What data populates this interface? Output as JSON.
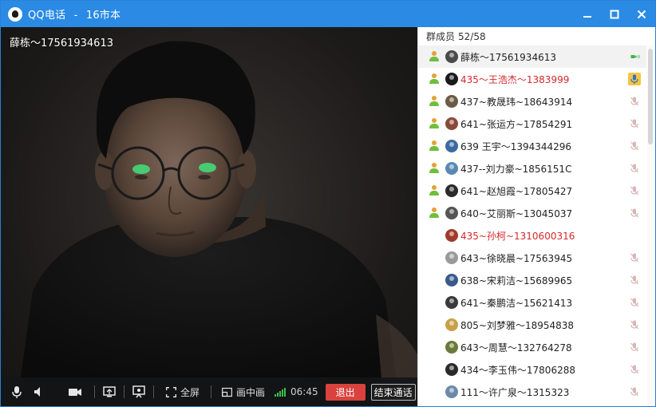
{
  "window": {
    "app_name": "QQ电话",
    "title_sep": "-",
    "group_name": "16市本"
  },
  "video": {
    "caller_label": "薛栋～17561934613"
  },
  "toolbar": {
    "fullscreen_label": "全屏",
    "pip_label": "画中画",
    "call_time": "06:45",
    "exit_label": "退出",
    "end_call_label": "结束通话"
  },
  "panel": {
    "header_label": "群成员",
    "member_count": "52/58"
  },
  "members": [
    {
      "name": "薛栋～17561934613",
      "role_icon": "person-icon",
      "status": "video",
      "red": false,
      "avatar_color": "#4a4a4a"
    },
    {
      "name": "435～王浩杰～1383999",
      "role_icon": "person-icon",
      "status": "speaking",
      "red": true,
      "avatar_color": "#1a1a1a"
    },
    {
      "name": "437~教晟玮~18643914",
      "role_icon": "person-icon",
      "status": "muted",
      "red": false,
      "avatar_color": "#6b5a45"
    },
    {
      "name": "641~张运方~17854291",
      "role_icon": "person-icon",
      "status": "muted",
      "red": false,
      "avatar_color": "#8a4a3a"
    },
    {
      "name": "639 王宇～1394344296",
      "role_icon": "person-icon",
      "status": "muted",
      "red": false,
      "avatar_color": "#3a6aa0"
    },
    {
      "name": "437--刘力豪~1856151C",
      "role_icon": "person-icon",
      "status": "muted",
      "red": false,
      "avatar_color": "#5a8ab0"
    },
    {
      "name": "641~赵旭霞~17805427",
      "role_icon": "person-icon",
      "status": "muted",
      "red": false,
      "avatar_color": "#2a2a2a"
    },
    {
      "name": "640~艾丽斯~13045037",
      "role_icon": "person-icon",
      "status": "muted",
      "red": false,
      "avatar_color": "#555555"
    },
    {
      "name": "435~孙柯~1310600316",
      "role_icon": "none",
      "status": "none",
      "red": true,
      "avatar_color": "#a03a2a"
    },
    {
      "name": "643~徐晓晨~17563945",
      "role_icon": "none",
      "status": "muted",
      "red": false,
      "avatar_color": "#9a9a9a"
    },
    {
      "name": "638~宋莉洁~15689965",
      "role_icon": "none",
      "status": "muted",
      "red": false,
      "avatar_color": "#3a5a8a"
    },
    {
      "name": "641~秦鹏洁~15621413",
      "role_icon": "none",
      "status": "muted",
      "red": false,
      "avatar_color": "#3a3a3a"
    },
    {
      "name": "805~刘梦雅～18954838",
      "role_icon": "none",
      "status": "muted",
      "red": false,
      "avatar_color": "#c9a04a"
    },
    {
      "name": "643～周慧～132764278",
      "role_icon": "none",
      "status": "muted",
      "red": false,
      "avatar_color": "#6a7a3a"
    },
    {
      "name": "434～李玉伟～17806288",
      "role_icon": "none",
      "status": "muted",
      "red": false,
      "avatar_color": "#2a2a2a"
    },
    {
      "name": "111～许广泉～1315323",
      "role_icon": "none",
      "status": "muted",
      "red": false,
      "avatar_color": "#6a8aa8"
    }
  ]
}
